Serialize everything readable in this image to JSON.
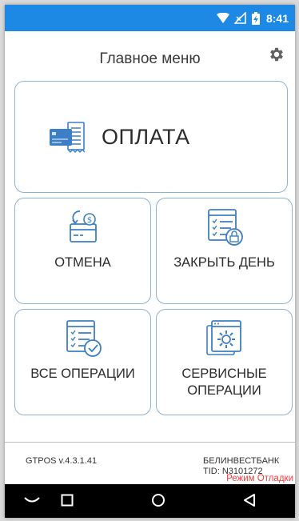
{
  "status_bar": {
    "time": "8:41",
    "background_color": "#1e88e5",
    "icons": [
      "wifi-icon",
      "no-signal-icon",
      "battery-charging-icon"
    ]
  },
  "header": {
    "title": "Главное меню",
    "settings_icon": "gear-icon"
  },
  "menu": {
    "payment": {
      "label": "ОПЛАТА",
      "icon": "card-receipt-icon"
    },
    "cancel": {
      "label": "ОТМЕНА",
      "icon": "card-refund-icon"
    },
    "close_day": {
      "label": "ЗАКРЫТЬ ДЕНЬ",
      "icon": "report-lock-icon"
    },
    "all_operations": {
      "label": "ВСЕ ОПЕРАЦИИ",
      "icon": "report-check-icon"
    },
    "service_operations": {
      "label_line1": "СЕРВИСНЫЕ",
      "label_line2": "ОПЕРАЦИИ",
      "icon": "report-gear-icon"
    }
  },
  "footer": {
    "version": "GTPOS v.4.3.1.41",
    "bank": "БЕЛИНВЕСТБАНК",
    "tid": "TID: N3101272",
    "debug_mode": "Режим Отладки"
  },
  "nav": {
    "icons": [
      "keyboard-hide-icon",
      "recents-icon",
      "home-icon",
      "back-icon"
    ]
  },
  "colors": {
    "accent": "#1e88e5",
    "tile_border": "#8cb2d4",
    "debug_text": "#ff3b3b"
  }
}
